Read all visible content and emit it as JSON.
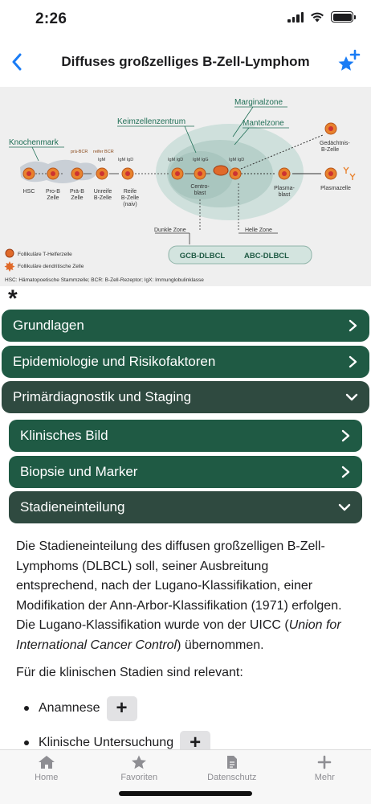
{
  "status": {
    "time": "2:26"
  },
  "nav": {
    "title": "Diffuses großzelliges B-Zell-Lymphom"
  },
  "figure": {
    "labels": {
      "marginalzone": "Marginalzone",
      "keimzentrum": "Keimzellenzentrum",
      "mantelzone": "Mantelzone",
      "knochenmark": "Knochenmark",
      "gedaechtnis": "Gedächtnis-",
      "gedaechtnis2": "B-Zelle",
      "prae_bcr": "prä-BCR",
      "reifer_bcr": "reifer BCR",
      "igm1": "IgM",
      "igm_igd1": "IgM IgD",
      "igm_igd2": "IgM IgD",
      "igm_igg": "IgM IgG",
      "igm_igd3": "IgM IgD",
      "hsc": "HSC",
      "prob1": "Pro-B",
      "prob2": "Zelle",
      "praeb1": "Prä-B",
      "praeb2": "Zelle",
      "unreife1": "Unreife",
      "unreife2": "B-Zelle",
      "reife1": "Reife",
      "reife2": "B-Zelle",
      "reife3": "(naiv)",
      "centro1": "Centro-",
      "centro2": "blast",
      "plasma1": "Plasma-",
      "plasma2": "blast",
      "plasmazelle": "Plasmazelle",
      "dunkle": "Dunkle Zone",
      "helle": "Helle Zone",
      "gcb": "GCB-DLBCL",
      "abc": "ABC-DLBCL",
      "legend1": "Follikuläre T-Helferzelle",
      "legend2": "Follikuläre dendritische Zelle",
      "footnote": "HSC: Hämatopoetische Stammzelle; BCR: B-Zell-Rezeptor; IgX: Immunglobulinklasse"
    }
  },
  "asterisk": "*",
  "sections": [
    {
      "label": "Grundlagen",
      "state": "collapsed"
    },
    {
      "label": "Epidemiologie und Risikofaktoren",
      "state": "collapsed"
    },
    {
      "label": "Primärdiagnostik und Staging",
      "state": "expanded"
    }
  ],
  "subsections": [
    {
      "label": "Klinisches Bild",
      "state": "collapsed"
    },
    {
      "label": "Biopsie und Marker",
      "state": "collapsed"
    },
    {
      "label": "Stadieneinteilung",
      "state": "expanded"
    }
  ],
  "content": {
    "para1_a": "Die Stadieneinteilung des diffusen großzelligen B-Zell-Lymphoms (DLBCL) soll, seiner Ausbreitung entsprechend, nach der Lugano-Klassifikation, einer Modifikation der Ann-Arbor-Klassifikation (1971) erfolgen. Die Lugano-Klassifikation wurde von der UICC (",
    "para1_em": "Union for International Cancer Control",
    "para1_b": ") übernommen.",
    "para2": "Für die klinischen Stadien sind relevant:",
    "bullets": [
      "Anamnese",
      "Klinische Untersuchung"
    ],
    "expand_symbol": "+"
  },
  "tabs": [
    {
      "label": "Home",
      "icon": "house-icon"
    },
    {
      "label": "Favoriten",
      "icon": "star-icon"
    },
    {
      "label": "Datenschutz",
      "icon": "document-icon"
    },
    {
      "label": "Mehr",
      "icon": "plus-icon"
    }
  ],
  "colors": {
    "accent": "#1a7cf5",
    "section_bg": "#1f5a44",
    "section_open_bg": "#2f4a40",
    "figure_cell": "#e9822e"
  }
}
